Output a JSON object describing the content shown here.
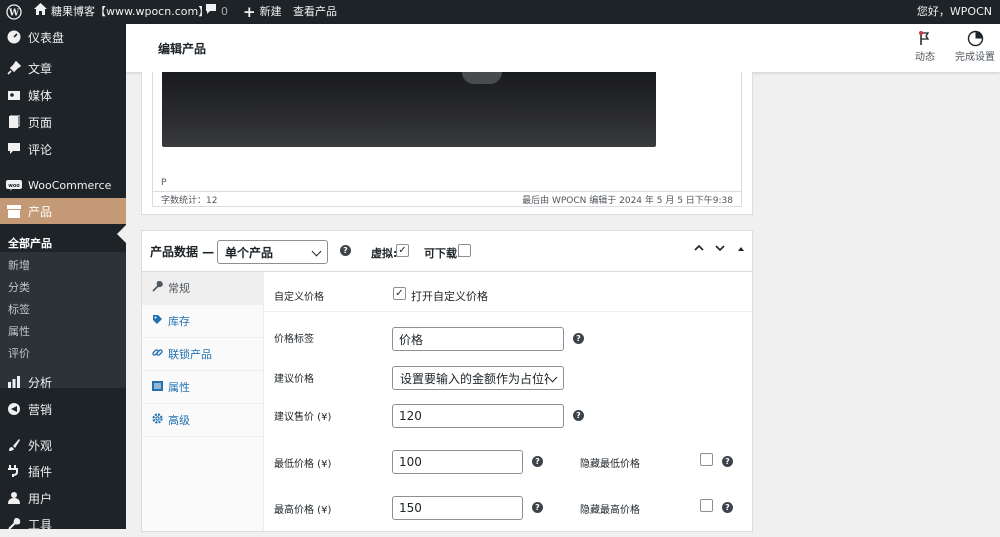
{
  "adminbar": {
    "site_name": "糖果博客【www.wpocn.com】",
    "comments_count": "0",
    "new_label": "新建",
    "view_label": "查看产品",
    "greeting": "您好，WPOCN"
  },
  "sidebar": {
    "items": [
      {
        "label": "仪表盘",
        "icon": "dashboard-icon"
      },
      {
        "label": "文章",
        "icon": "pin-icon"
      },
      {
        "label": "媒体",
        "icon": "media-icon"
      },
      {
        "label": "页面",
        "icon": "page-icon"
      },
      {
        "label": "评论",
        "icon": "comment-icon"
      },
      {
        "label": "WooCommerce",
        "icon": "woo-icon"
      },
      {
        "label": "产品",
        "icon": "archive-icon"
      },
      {
        "label": "分析",
        "icon": "chart-icon"
      },
      {
        "label": "营销",
        "icon": "megaphone-icon"
      },
      {
        "label": "外观",
        "icon": "brush-icon"
      },
      {
        "label": "插件",
        "icon": "plugin-icon"
      },
      {
        "label": "用户",
        "icon": "user-icon"
      },
      {
        "label": "工具",
        "icon": "tool-icon"
      }
    ],
    "submenu": [
      "全部产品",
      "新增",
      "分类",
      "标签",
      "属性",
      "评价"
    ]
  },
  "header": {
    "title": "编辑产品",
    "activity_label": "动态",
    "finish_setup_label": "完成设置"
  },
  "editor": {
    "path": "P",
    "word_count": "字数统计：12",
    "last_edited": "最后由 WPOCN 编辑于 2024 年 5 月 5 日下午9:38"
  },
  "product_data": {
    "title": "产品数据 —",
    "type_selected": "单个产品",
    "virtual_label": "虚拟:",
    "virtual_checked": true,
    "downloadable_label": "可下载:",
    "downloadable_checked": false,
    "tabs": [
      {
        "label": "常规",
        "icon": "wrench-icon"
      },
      {
        "label": "库存",
        "icon": "tag-icon"
      },
      {
        "label": "联锁产品",
        "icon": "link-icon"
      },
      {
        "label": "属性",
        "icon": "list-icon"
      },
      {
        "label": "高级",
        "icon": "gear-icon"
      }
    ],
    "fields": {
      "custom_price_label": "自定义价格",
      "custom_price_checkbox": "打开自定义价格",
      "price_label_label": "价格标签",
      "price_label_value": "价格",
      "suggested_price_label": "建议价格",
      "suggested_price_value": "设置要输入的金额作为占位符",
      "suggested_sale_label": "建议售价 (¥)",
      "suggested_sale_value": "120",
      "min_price_label": "最低价格 (¥)",
      "min_price_value": "100",
      "hide_min_label": "隐藏最低价格",
      "max_price_label": "最高价格 (¥)",
      "max_price_value": "150",
      "hide_max_label": "隐藏最高价格"
    }
  },
  "colors": {
    "sidebar_bg": "#1d2327",
    "current_menu": "#c39a75",
    "link": "#2271b1"
  }
}
